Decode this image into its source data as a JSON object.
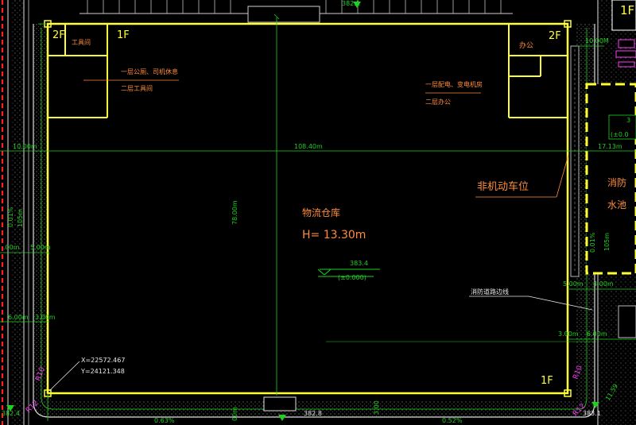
{
  "drawing": {
    "elev_top": "382.1",
    "elev_bottom_left": "382.4",
    "elev_bottom_mid": "382.8",
    "elev_bottom_right": "383.1",
    "floor_2f_left": "2F",
    "floor_1f_left": "1F",
    "floor_2f_right": "2F",
    "floor_1f_bottom": "1F",
    "room_toolroom": "工具间",
    "room_office": "办公",
    "note_left_1": "一层公厕、司机休息",
    "note_left_2": "二层工具间",
    "note_right_1": "一层配电、变电机房",
    "note_right_2": "二层办公",
    "dim_width": "108.40m",
    "dim_depth": "78.00m",
    "dim_left_10": "10.00m",
    "dim_right_10": "10.00M",
    "dim_right_17": "17.13m",
    "dim_left_5a": ".00m",
    "dim_left_5b": "5.00m",
    "dim_left_6": "6.00m",
    "dim_left_3": "3.00m",
    "dim_right_5": "5.00m",
    "dim_right_4": "4.00m",
    "dim_right_3": "3.00m",
    "dim_right_6": "6.00m",
    "slope_left_1": "0.01%",
    "slope_left_2": "105m",
    "slope_right_1": "0.01%",
    "slope_right_2": "105m",
    "slope_bottom_left": "0.63%",
    "slope_bottom_right": "0.52%",
    "dim_bottom_a": "00m",
    "dim_bottom_b": "3.00",
    "label_bike_parking": "非机动车位",
    "warehouse_name": "物流仓库",
    "warehouse_height": "H= 13.30m",
    "elev_floor": "383.4",
    "elev_floor_relative": "(±0.000)",
    "label_fire_road": "消防道路边线",
    "coord_x": "X=22572.467",
    "coord_y": "Y=24121.348",
    "radius_r10_left": "R10",
    "radius_r12_left": "R12",
    "radius_r10_right": "R10",
    "radius_r12_right": "R12",
    "fire_pool_1": "消防",
    "fire_pool_2": "水池",
    "right_1f": "1F",
    "right_partial_3": "3",
    "right_partial_elev": "(±0.0",
    "right_partial_11": "11.59"
  },
  "colors": {
    "building": "#ffff33",
    "dimension": "#1fd11f",
    "annotation": "#ff8c3a",
    "text": "#e8e8e8",
    "landscape": "#ff3cff"
  }
}
